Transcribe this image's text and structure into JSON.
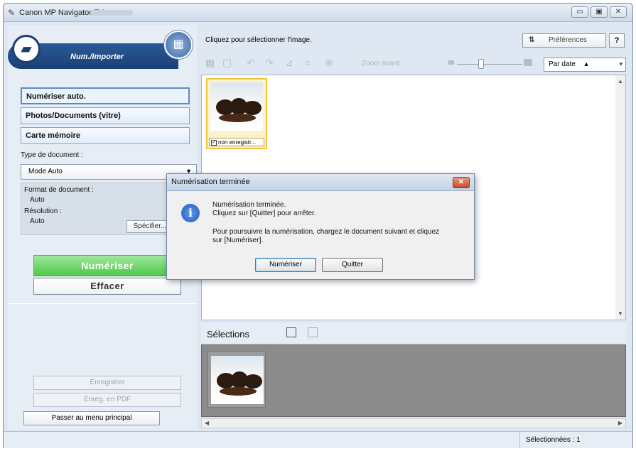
{
  "window": {
    "title": "Canon MP Navigator EX",
    "controls": [
      "▭",
      "▣",
      "✕"
    ]
  },
  "left": {
    "header_label": "Num./Importer",
    "modes": [
      "Numériser auto.",
      "Photos/Documents (vitre)",
      "Carte mémoire"
    ],
    "doc_type_label": "Type de document :",
    "doc_type_value": "Mode Auto",
    "format_label": "Format de document :",
    "format_value": "Auto",
    "resolution_label": "Résolution :",
    "resolution_value": "Auto",
    "specify_label": "Spécifier...",
    "scan_label": "Numériser",
    "clear_label": "Effacer",
    "save_label": "Enregistrer",
    "save_pdf_label": "Enreg. en PDF",
    "main_menu_label": "Passer au menu principal"
  },
  "right": {
    "hint": "Cliquez pour sélectionner l'image.",
    "prefs_label": "Préférences",
    "help_label": "?",
    "zoom_label": "Zoom avant",
    "sort_value": "Par date",
    "thumb_caption": "non enregistr...",
    "selections_label": "Sélections",
    "status_selected": "Sélectionnées : 1"
  },
  "dialog": {
    "title": "Numérisation terminée",
    "line1": "Numérisation terminée.",
    "line2": "Cliquez sur [Quitter] pour arrêter.",
    "line3": "Pour poursuivre la numérisation, chargez le document suivant et cliquez",
    "line4": "sur [Numériser].",
    "scan_button": "Numériser",
    "quit_button": "Quitter"
  }
}
